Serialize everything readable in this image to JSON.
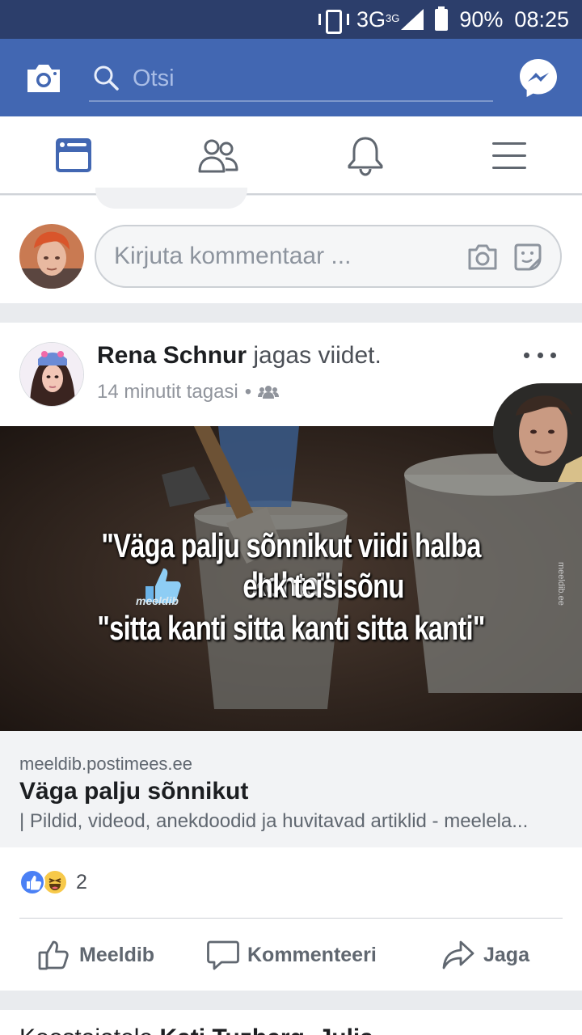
{
  "status_bar": {
    "network": "3G",
    "network_sup": "3G",
    "battery": "90%",
    "time": "08:25"
  },
  "header": {
    "search_placeholder": "Otsi"
  },
  "composer": {
    "placeholder": "Kirjuta kommentaar ..."
  },
  "post": {
    "author": "Rena Schnur",
    "action": "jagas viidet.",
    "time": "14 minutit tagasi",
    "image_text": {
      "line1": "\"Väga palju sõnnikut viidi halba kohta\"",
      "line2": "ehk teisisõnu",
      "line3": "\"sitta kanti sitta kanti sitta kanti\"",
      "watermark": "meeldib",
      "side_mark": "meeldib.ee"
    },
    "link": {
      "domain": "meeldib.postimees.ee",
      "title": "Väga palju sõnnikut",
      "description": "| Pildid, videod, anekdoodid ja huvitavad artiklid - meelela..."
    },
    "reaction_count": "2",
    "actions": {
      "like": "Meeldib",
      "comment": "Kommenteeri",
      "share": "Jaga"
    }
  },
  "next_post": {
    "prefix": "Koostajatele ",
    "names": "Kati Tuzberg, Julia"
  },
  "colors": {
    "brand": "#4267b2",
    "status_bar": "#2c3e6b",
    "active_nav": "#4267b2"
  }
}
